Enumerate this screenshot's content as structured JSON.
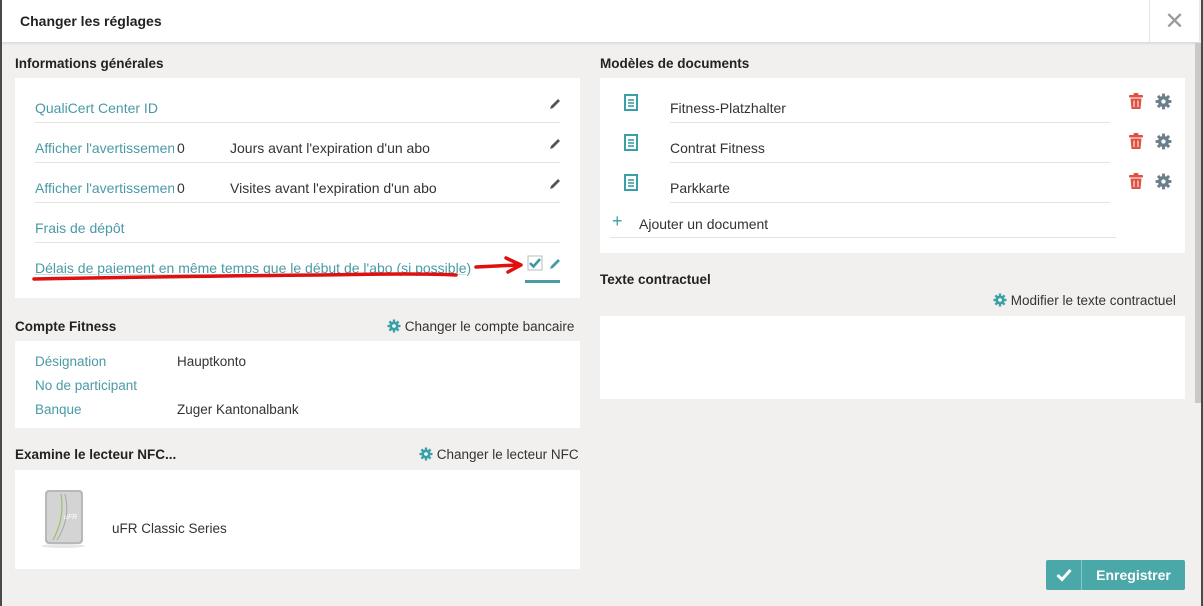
{
  "dialog": {
    "title": "Changer les réglages",
    "close_glyph": "✕"
  },
  "general": {
    "title": "Informations générales",
    "rows": [
      {
        "label": "QualiCert Center ID",
        "value": "",
        "unit": ""
      },
      {
        "label": "Afficher l'avertissement",
        "value": "0",
        "unit": "Jours avant l'expiration d'un abo"
      },
      {
        "label": "Afficher l'avertissement",
        "value": "0",
        "unit": "Visites avant l'expiration d'un abo"
      },
      {
        "label": "Frais de dépôt",
        "value": "",
        "unit": ""
      },
      {
        "label": "Délais de paiement en même temps que le début de l'abo (si possible)",
        "value": "",
        "unit": ""
      }
    ]
  },
  "fitness_account": {
    "title": "Compte Fitness",
    "change_label": "Changer le compte bancaire",
    "rows": [
      {
        "key": "Désignation",
        "value": "Hauptkonto"
      },
      {
        "key": "No de participant",
        "value": ""
      },
      {
        "key": "Banque",
        "value": "Zuger Kantonalbank"
      }
    ]
  },
  "nfc": {
    "title": "Examine le lecteur NFC...",
    "change_label": "Changer le lecteur NFC",
    "device_name": "uFR Classic Series",
    "device_logo_text": "uFR"
  },
  "documents": {
    "title": "Modèles de documents",
    "items": [
      "Fitness-Platzhalter",
      "Contrat Fitness",
      "Parkkarte"
    ],
    "add_label": "Ajouter un document"
  },
  "contract_text": {
    "title": "Texte contractuel",
    "edit_label": "Modifier le texte contractuel"
  },
  "save_label": "Enregistrer",
  "colors": {
    "teal": "#4a9aa6",
    "button": "#4aa8a8",
    "trash": "#e05040",
    "gear": "#6a7f8a",
    "annotation": "#e01010"
  }
}
